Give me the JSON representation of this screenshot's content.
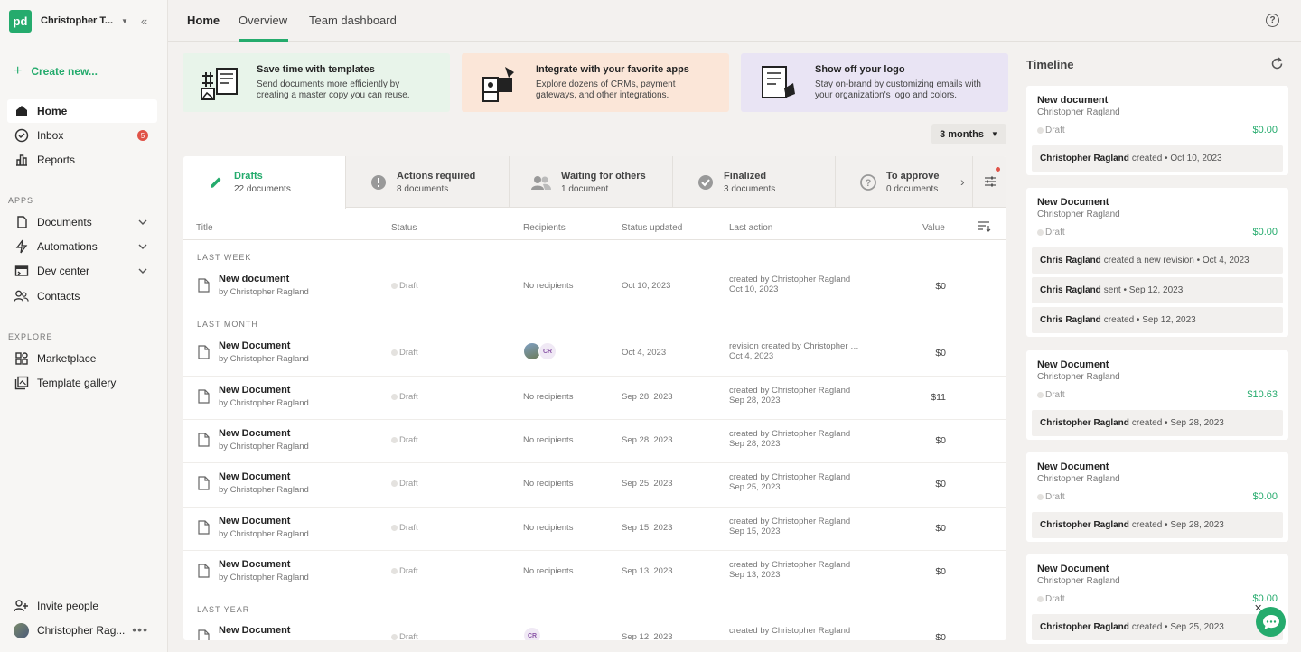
{
  "sidebar": {
    "logo_text": "pd",
    "workspace": "Christopher T...",
    "create_new": "Create new...",
    "nav_main": [
      {
        "label": "Home",
        "icon": "home-icon"
      },
      {
        "label": "Inbox",
        "icon": "inbox-icon",
        "badge": "5"
      },
      {
        "label": "Reports",
        "icon": "reports-icon"
      }
    ],
    "apps_label": "APPS",
    "apps": [
      {
        "label": "Documents",
        "icon": "documents-icon"
      },
      {
        "label": "Automations",
        "icon": "automations-icon"
      },
      {
        "label": "Dev center",
        "icon": "dev-center-icon"
      },
      {
        "label": "Contacts",
        "icon": "contacts-icon"
      }
    ],
    "explore_label": "EXPLORE",
    "explore": [
      {
        "label": "Marketplace",
        "icon": "marketplace-icon"
      },
      {
        "label": "Template gallery",
        "icon": "template-gallery-icon"
      }
    ],
    "invite": "Invite people",
    "user": "Christopher Rag..."
  },
  "top_tabs": [
    "Home",
    "Overview",
    "Team dashboard"
  ],
  "promos": [
    {
      "title": "Save time with templates",
      "body": "Send documents more efficiently by creating a master copy you can reuse.",
      "bg": "#e8f4ea"
    },
    {
      "title": "Integrate with your favorite apps",
      "body": "Explore dozens of CRMs, payment gateways, and other integrations.",
      "bg": "#fbe6d8"
    },
    {
      "title": "Show off your logo",
      "body": "Stay on-brand by customizing emails with your organization's logo and colors.",
      "bg": "#e9e4f4"
    }
  ],
  "range": "3 months",
  "status_tabs": [
    {
      "label": "Drafts",
      "count": "22 documents"
    },
    {
      "label": "Actions required",
      "count": "8 documents"
    },
    {
      "label": "Waiting for others",
      "count": "1 document"
    },
    {
      "label": "Finalized",
      "count": "3 documents"
    },
    {
      "label": "To approve",
      "count": "0 documents"
    }
  ],
  "columns": [
    "Title",
    "Status",
    "Recipients",
    "Status updated",
    "Last action",
    "Value"
  ],
  "groups": [
    "LAST WEEK",
    "LAST MONTH",
    "LAST YEAR"
  ],
  "rows": [
    {
      "title": "New document",
      "by": "by Christopher Ragland",
      "status": "Draft",
      "recipients": "No recipients",
      "updated": "Oct 10, 2023",
      "action1": "created by Christopher Ragland",
      "action2": "Oct 10, 2023",
      "value": "$0"
    },
    {
      "title": "New Document",
      "by": "by Christopher Ragland",
      "status": "Draft",
      "recipients": "",
      "avatar_initials": "CR",
      "updated": "Oct 4, 2023",
      "action1": "revision created by Christopher Ragland",
      "action2": "Oct 4, 2023",
      "value": "$0"
    },
    {
      "title": "New Document",
      "by": "by Christopher Ragland",
      "status": "Draft",
      "recipients": "No recipients",
      "updated": "Sep 28, 2023",
      "action1": "created by Christopher Ragland",
      "action2": "Sep 28, 2023",
      "value": "$11"
    },
    {
      "title": "New Document",
      "by": "by Christopher Ragland",
      "status": "Draft",
      "recipients": "No recipients",
      "updated": "Sep 28, 2023",
      "action1": "created by Christopher Ragland",
      "action2": "Sep 28, 2023",
      "value": "$0"
    },
    {
      "title": "New Document",
      "by": "by Christopher Ragland",
      "status": "Draft",
      "recipients": "No recipients",
      "updated": "Sep 25, 2023",
      "action1": "created by Christopher Ragland",
      "action2": "Sep 25, 2023",
      "value": "$0"
    },
    {
      "title": "New Document",
      "by": "by Christopher Ragland",
      "status": "Draft",
      "recipients": "No recipients",
      "updated": "Sep 15, 2023",
      "action1": "created by Christopher Ragland",
      "action2": "Sep 15, 2023",
      "value": "$0"
    },
    {
      "title": "New Document",
      "by": "by Christopher Ragland",
      "status": "Draft",
      "recipients": "No recipients",
      "updated": "Sep 13, 2023",
      "action1": "created by Christopher Ragland",
      "action2": "Sep 13, 2023",
      "value": "$0"
    },
    {
      "title": "New Document",
      "by": "",
      "status": "Draft",
      "recipients": "",
      "avatar_initials": "CR",
      "updated": "Sep 12, 2023",
      "action1": "created by Christopher Ragland",
      "action2": "",
      "value": "$0"
    }
  ],
  "timeline": {
    "title": "Timeline",
    "cards": [
      {
        "title": "New document",
        "author": "Christopher Ragland",
        "status": "Draft",
        "value": "$0.00",
        "events": [
          {
            "who": "Christopher Ragland",
            "what": "created • Oct 10, 2023"
          }
        ]
      },
      {
        "title": "New Document",
        "author": "Christopher Ragland",
        "status": "Draft",
        "value": "$0.00",
        "events": [
          {
            "who": "Chris Ragland",
            "what": "created a new revision • Oct 4, 2023"
          },
          {
            "who": "Chris Ragland",
            "what": "sent • Sep 12, 2023"
          },
          {
            "who": "Chris Ragland",
            "what": "created • Sep 12, 2023"
          }
        ]
      },
      {
        "title": "New Document",
        "author": "Christopher Ragland",
        "status": "Draft",
        "value": "$10.63",
        "events": [
          {
            "who": "Christopher Ragland",
            "what": "created • Sep 28, 2023"
          }
        ]
      },
      {
        "title": "New Document",
        "author": "Christopher Ragland",
        "status": "Draft",
        "value": "$0.00",
        "events": [
          {
            "who": "Christopher Ragland",
            "what": "created • Sep 28, 2023"
          }
        ]
      },
      {
        "title": "New Document",
        "author": "Christopher Ragland",
        "status": "Draft",
        "value": "$0.00",
        "events": [
          {
            "who": "Christopher Ragland",
            "what": "created • Sep 25, 2023"
          }
        ]
      }
    ]
  },
  "colors": {
    "accent": "#25ab6d",
    "badge": "#e05348"
  }
}
